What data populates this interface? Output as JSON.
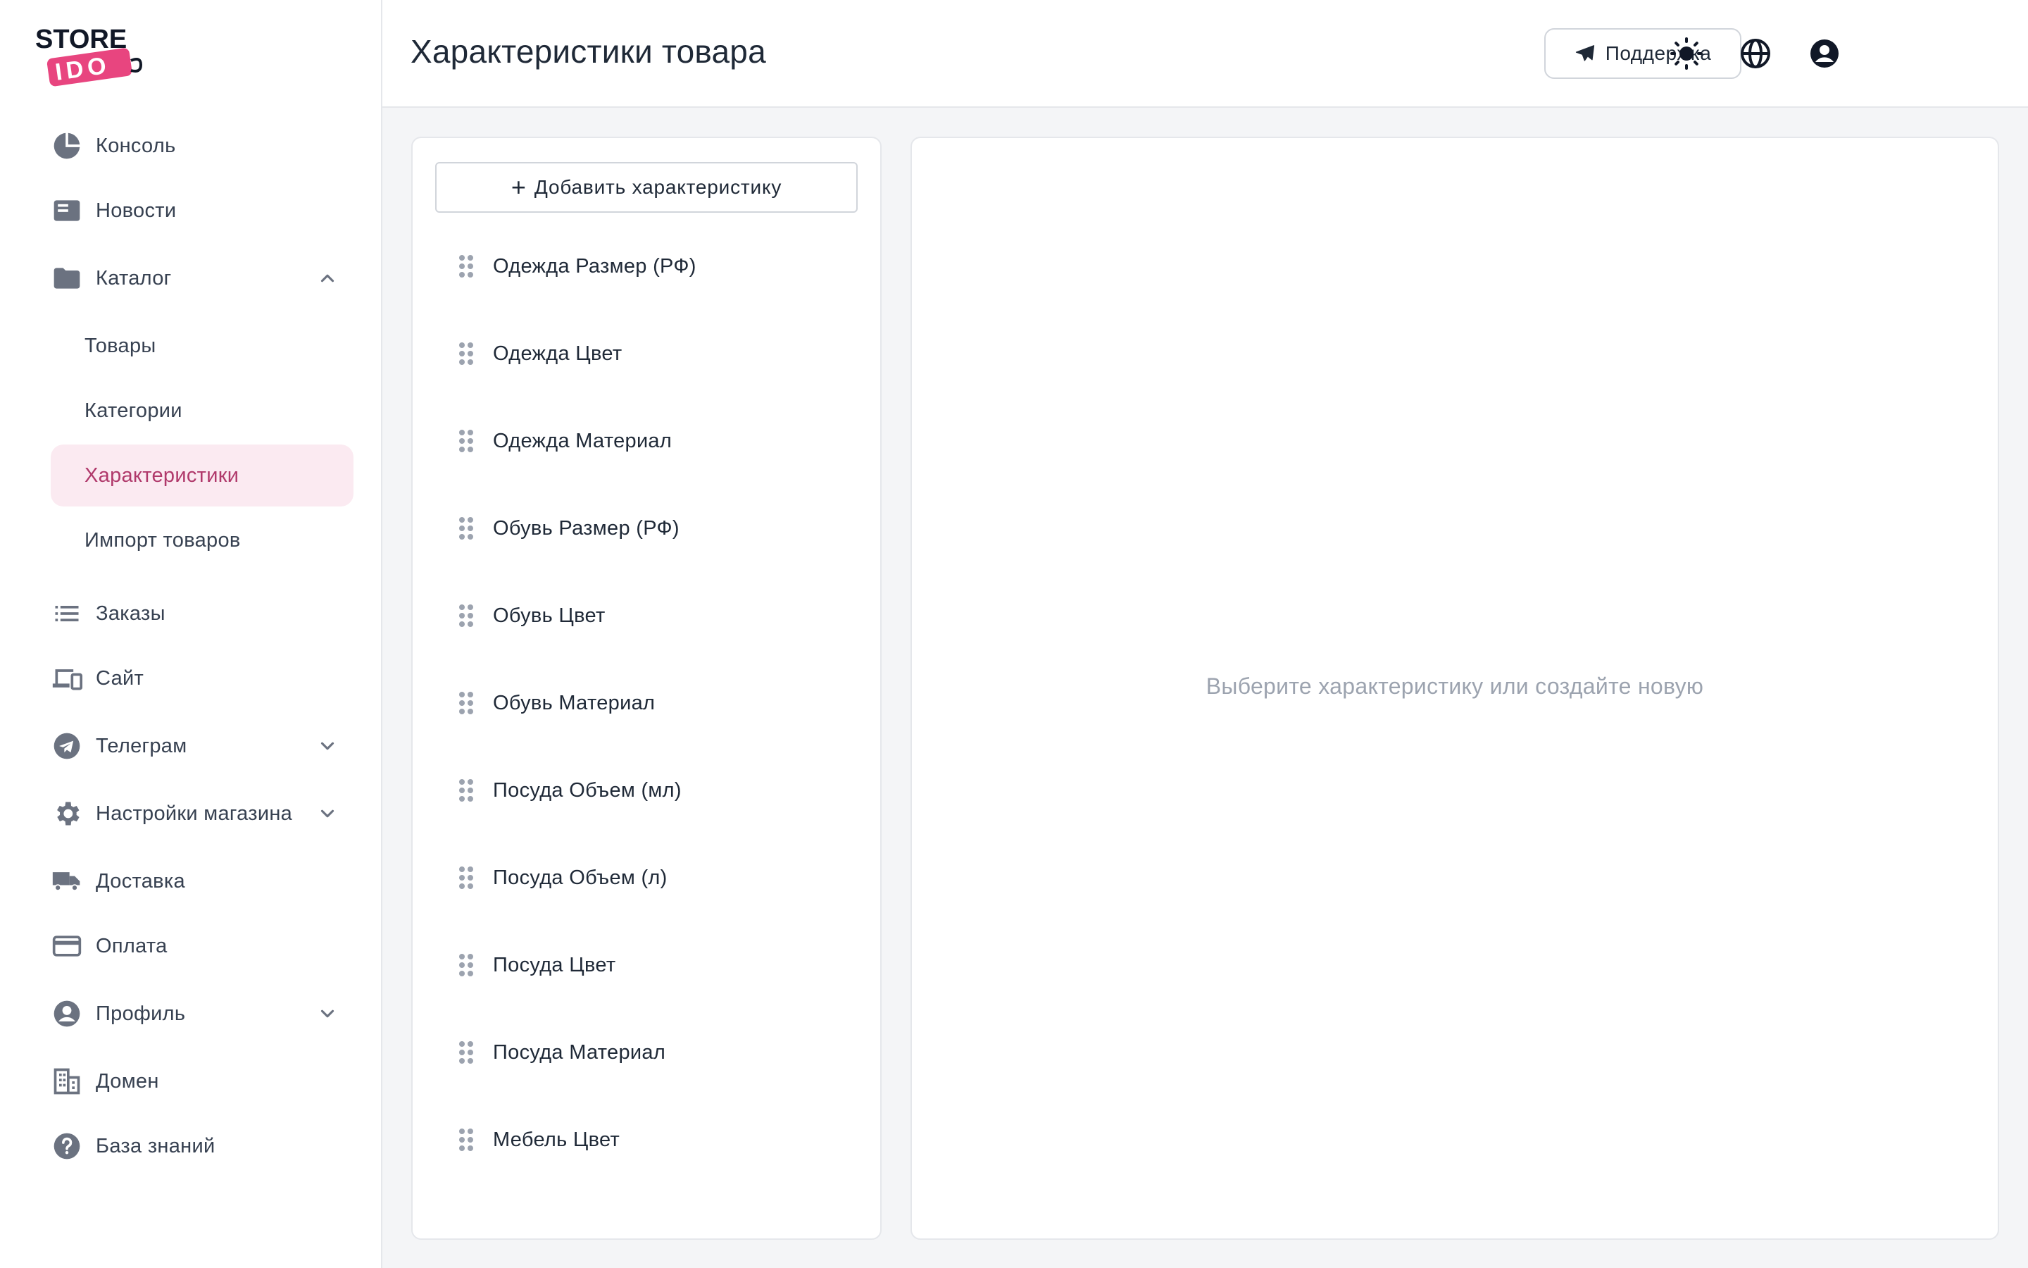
{
  "brand": {
    "logo_top": "STORE",
    "logo_bottom": "IDO"
  },
  "colors": {
    "accent": "#b0396b",
    "accent_bg": "#fbeaf1",
    "logo_pink": "#e8457f",
    "icon_gray": "#6b7280"
  },
  "sidebar": {
    "items": [
      {
        "label": "Консоль",
        "icon": "chart-pie-icon"
      },
      {
        "label": "Новости",
        "icon": "newspaper-icon"
      },
      {
        "label": "Каталог",
        "icon": "folder-icon",
        "expanded": true
      },
      {
        "label": "Заказы",
        "icon": "list-icon"
      },
      {
        "label": "Сайт",
        "icon": "devices-icon"
      },
      {
        "label": "Телеграм",
        "icon": "telegram-icon"
      },
      {
        "label": "Настройки магазина",
        "icon": "gear-icon"
      },
      {
        "label": "Доставка",
        "icon": "truck-icon"
      },
      {
        "label": "Оплата",
        "icon": "credit-card-icon"
      },
      {
        "label": "Профиль",
        "icon": "user-circle-icon"
      },
      {
        "label": "Домен",
        "icon": "building-icon"
      },
      {
        "label": "База знаний",
        "icon": "help-circle-icon"
      }
    ],
    "catalog_sub": [
      {
        "label": "Товары"
      },
      {
        "label": "Категории"
      },
      {
        "label": "Характеристики",
        "active": true
      },
      {
        "label": "Импорт товаров"
      }
    ]
  },
  "header": {
    "title": "Характеристики товара",
    "support_label": "Поддержка"
  },
  "list": {
    "add_label": "Добавить характеристику",
    "items": [
      "Одежда Размер (РФ)",
      "Одежда Цвет",
      "Одежда Материал",
      "Обувь Размер (РФ)",
      "Обувь Цвет",
      "Обувь Материал",
      "Посуда Объем (мл)",
      "Посуда Объем (л)",
      "Посуда Цвет",
      "Посуда Материал",
      "Мебель Цвет"
    ]
  },
  "detail": {
    "empty_message": "Выберите характеристику или создайте новую"
  }
}
